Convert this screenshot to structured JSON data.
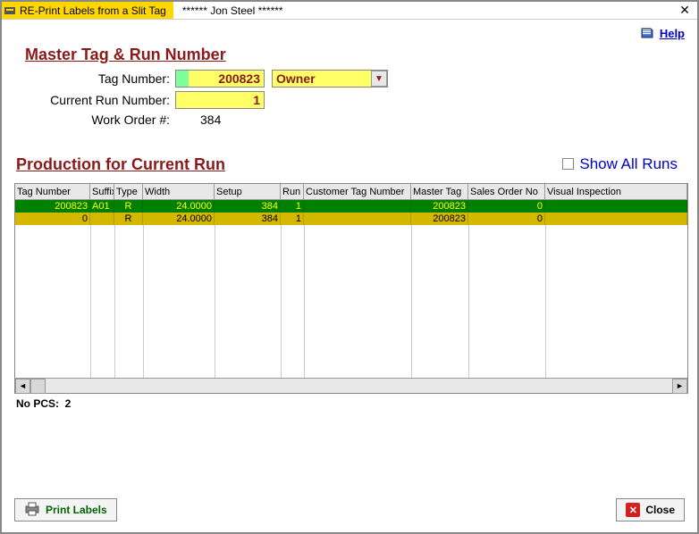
{
  "titlebar": {
    "title": "RE-Print Labels from a Slit Tag",
    "subtitle": "****** Jon Steel ******"
  },
  "help": {
    "label": "Help"
  },
  "section1": {
    "title": "Master Tag & Run Number",
    "tag_label": "Tag Number:",
    "tag_value": "200823",
    "dropdown_value": "Owner",
    "run_label": "Current Run Number:",
    "run_value": "1",
    "wo_label": "Work Order #:",
    "wo_value": "384"
  },
  "section2": {
    "title": "Production for Current Run",
    "show_all_label": "Show All Runs",
    "columns": [
      "Tag Number",
      "Suffix",
      "Type",
      "Width",
      "Setup",
      "Run",
      "Customer Tag Number",
      "Master Tag",
      "Sales Order No",
      "Visual Inspection"
    ],
    "rows": [
      {
        "tag": "200823",
        "suffix": "A01",
        "type": "R",
        "width": "24.0000",
        "setup": "384",
        "run": "1",
        "cust": "",
        "master": "200823",
        "so": "0",
        "vi": "",
        "cls": "row-green"
      },
      {
        "tag": "0",
        "suffix": "",
        "type": "R",
        "width": "24.0000",
        "setup": "384",
        "run": "1",
        "cust": "",
        "master": "200823",
        "so": "0",
        "vi": "",
        "cls": "row-yellow"
      }
    ],
    "pcs_label": "No PCS:",
    "pcs_value": "2"
  },
  "footer": {
    "print_label": "Print Labels",
    "close_label": "Close"
  }
}
